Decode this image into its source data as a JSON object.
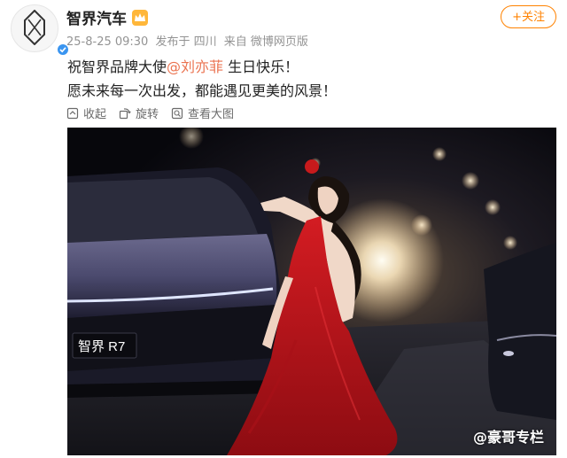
{
  "account": {
    "name": "智界汽车",
    "follow_label": "+关注"
  },
  "meta": {
    "time": "25-8-25 09:30",
    "location": "发布于 四川",
    "source": "来自 微博网页版"
  },
  "post": {
    "line1_prefix": "祝智界品牌大使",
    "mention": "@刘亦菲",
    "line1_suffix": " 生日快乐！",
    "line2": "愿未来每一次出发，都能遇见更美的风景！"
  },
  "actions": {
    "collect": "收起",
    "repost": "旋转",
    "view_large": "查看大图"
  },
  "photo": {
    "plate_text": "智界 R7",
    "watermark": "@豪哥专栏"
  },
  "colors": {
    "accent": "#ff8200",
    "mention": "#eb7350",
    "verified": "#3a95f0",
    "dress": "#c0181c"
  },
  "icons": {
    "avatar": "zhijie-logo-icon",
    "verified": "verified-badge-icon",
    "member": "crown-icon",
    "collect": "collapse-icon",
    "rotate": "rotate-icon",
    "view": "zoom-icon"
  }
}
